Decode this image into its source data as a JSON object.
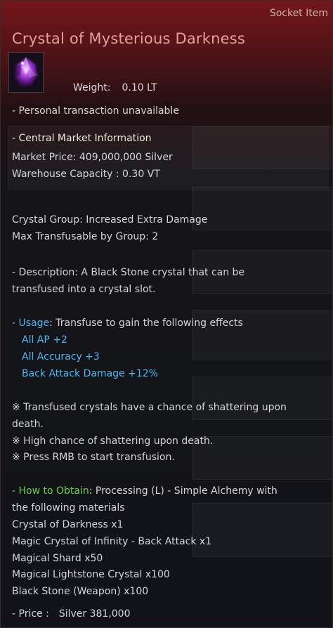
{
  "tooltip": {
    "item_type": "Socket Item",
    "item_name": "Crystal of Mysterious Darkness",
    "icon": "purple-crystal-icon",
    "weight_label": "Weight:",
    "weight_value": "0.10 LT",
    "personal_transaction": "- Personal transaction unavailable",
    "market": {
      "header": "- Central Market Information",
      "price": "Market Price: 409,000,000 Silver",
      "warehouse": "Warehouse Capacity : 0.30 VT"
    },
    "crystal_group": "Crystal Group: Increased Extra Damage",
    "max_transfusable": "Max Transfusable by Group: 2",
    "description_line1": "- Description: A Black Stone crystal that can be",
    "description_line2": "transfused into a crystal slot.",
    "usage": {
      "label": "- Usage",
      "text": ": Transfuse to gain the following effects",
      "effects": [
        "All AP +2",
        "All Accuracy +3",
        "Back Attack Damage +12%"
      ]
    },
    "notes": [
      "※ Transfused crystals have a chance of shattering upon",
      "death.",
      "※ High chance of shattering upon death.",
      "※ Press RMB to start transfusion."
    ],
    "how_to_obtain": {
      "label": "- How to Obtain",
      "text_line1": ": Processing (L) - Simple Alchemy with",
      "text_line2": "the following materials",
      "materials": [
        "Crystal of Darkness x1",
        "Magic Crystal of Infinity - Back Attack x1",
        "Magical Shard x50",
        "Magical Lightstone Crystal x100",
        "Black Stone (Weapon) x100"
      ]
    },
    "price_label": "- Price :",
    "price_value": "Silver 381,000"
  },
  "colors": {
    "item_name": "#e3a09a",
    "effect_blue": "#51b6f2",
    "obtain_green": "#66d24c",
    "header_red": "#7a161a"
  }
}
